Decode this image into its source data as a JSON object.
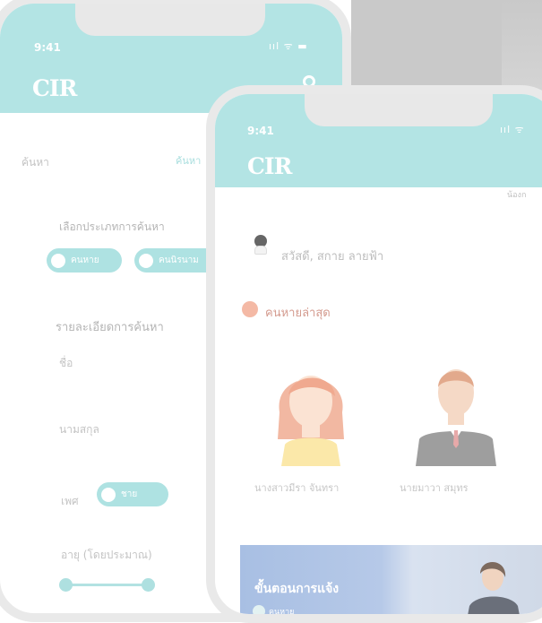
{
  "back_phone": {
    "status_time": "9:41",
    "status_icons": "ııl ᯤ ▬",
    "logo": "CIR",
    "settings_icon": "gear-icon",
    "search_title": "ค้นหา",
    "search_link": "ค้นหา",
    "select_type_label": "เลือกประเภทการค้นหา",
    "type_chips": [
      "คนหาย",
      "คนนิรนาม"
    ],
    "detail_label": "รายละเอียดการค้นหา",
    "name_label": "ชื่อ",
    "surname_label": "นามสกุล",
    "gender_label": "เพศ",
    "gender_chip": "ชาย",
    "age_label": "อายุ (โดยประมาณ)"
  },
  "front_phone": {
    "status_time": "9:41",
    "status_icons": "ııl ᯤ",
    "logo": "CIR",
    "greeting": "สวัสดี, สกาย ลายฟ้า",
    "recent_label": "คนหายล่าสุด",
    "persons": [
      {
        "name": "นางสาวมีรา จันทรา",
        "icon": "female-avatar-icon"
      },
      {
        "name": "นายมาวา สมุทร",
        "icon": "male-avatar-icon"
      }
    ],
    "banner_title": "ขั้นตอนการแจ้ง",
    "banner_chip": "คนหาย"
  },
  "edge_text": "น้องก",
  "colors": {
    "header": "#b3e4e4",
    "chip": "#aee2e2",
    "frame": "#e9e9e9"
  }
}
